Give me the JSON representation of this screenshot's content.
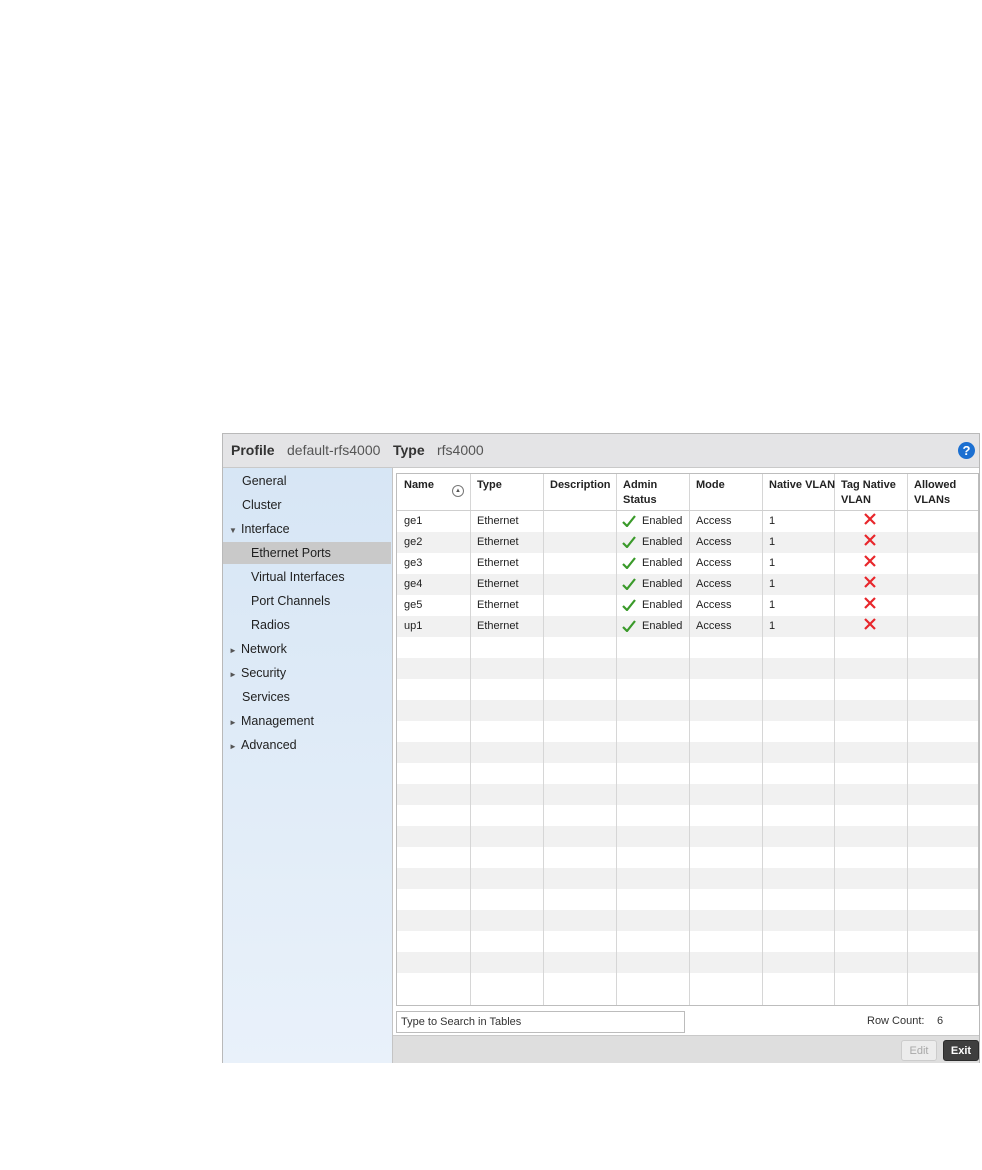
{
  "header": {
    "profile_label": "Profile",
    "profile_value": "default-rfs4000",
    "type_label": "Type",
    "type_value": "rfs4000",
    "help_glyph": "?"
  },
  "sidebar": {
    "items": [
      {
        "label": "General",
        "arrow": "",
        "indent": 0
      },
      {
        "label": "Cluster",
        "arrow": "",
        "indent": 0
      },
      {
        "label": "Interface",
        "arrow": "▼",
        "indent": 0
      },
      {
        "label": "Ethernet Ports",
        "arrow": "",
        "indent": 1,
        "selected": true
      },
      {
        "label": "Virtual Interfaces",
        "arrow": "",
        "indent": 1
      },
      {
        "label": "Port Channels",
        "arrow": "",
        "indent": 1
      },
      {
        "label": "Radios",
        "arrow": "",
        "indent": 1
      },
      {
        "label": "Network",
        "arrow": "►",
        "indent": 0
      },
      {
        "label": "Security",
        "arrow": "►",
        "indent": 0
      },
      {
        "label": "Services",
        "arrow": "",
        "indent": 0
      },
      {
        "label": "Management",
        "arrow": "►",
        "indent": 0
      },
      {
        "label": "Advanced",
        "arrow": "►",
        "indent": 0
      }
    ]
  },
  "table": {
    "columns": [
      {
        "line1": "Name",
        "line2": ""
      },
      {
        "line1": "Type",
        "line2": ""
      },
      {
        "line1": "Description",
        "line2": ""
      },
      {
        "line1": "Admin",
        "line2": "Status"
      },
      {
        "line1": "Mode",
        "line2": ""
      },
      {
        "line1": "Native VLAN",
        "line2": ""
      },
      {
        "line1": "Tag Native",
        "line2": "VLAN"
      },
      {
        "line1": "Allowed",
        "line2": "VLANs"
      }
    ],
    "rows": [
      {
        "name": "ge1",
        "type": "Ethernet",
        "description": "",
        "admin_status": "Enabled",
        "mode": "Access",
        "native_vlan": "1",
        "tag_native_vlan": false,
        "allowed_vlans": ""
      },
      {
        "name": "ge2",
        "type": "Ethernet",
        "description": "",
        "admin_status": "Enabled",
        "mode": "Access",
        "native_vlan": "1",
        "tag_native_vlan": false,
        "allowed_vlans": ""
      },
      {
        "name": "ge3",
        "type": "Ethernet",
        "description": "",
        "admin_status": "Enabled",
        "mode": "Access",
        "native_vlan": "1",
        "tag_native_vlan": false,
        "allowed_vlans": ""
      },
      {
        "name": "ge4",
        "type": "Ethernet",
        "description": "",
        "admin_status": "Enabled",
        "mode": "Access",
        "native_vlan": "1",
        "tag_native_vlan": false,
        "allowed_vlans": ""
      },
      {
        "name": "ge5",
        "type": "Ethernet",
        "description": "",
        "admin_status": "Enabled",
        "mode": "Access",
        "native_vlan": "1",
        "tag_native_vlan": false,
        "allowed_vlans": ""
      },
      {
        "name": "up1",
        "type": "Ethernet",
        "description": "",
        "admin_status": "Enabled",
        "mode": "Access",
        "native_vlan": "1",
        "tag_native_vlan": false,
        "allowed_vlans": ""
      }
    ]
  },
  "search": {
    "placeholder": "Type to Search in Tables",
    "value": ""
  },
  "row_count": {
    "label": "Row Count:",
    "value": "6"
  },
  "buttons": {
    "edit": "Edit",
    "exit": "Exit"
  },
  "colors": {
    "check": "#3a9a2a",
    "cross": "#e8262b",
    "help": "#1b6fd1",
    "selected_nav": "#c9c9c9"
  },
  "icons": {
    "status_enabled": "check-icon",
    "tag_native_off": "x-icon",
    "sort": "sort-ascending-icon",
    "help": "help-icon"
  }
}
